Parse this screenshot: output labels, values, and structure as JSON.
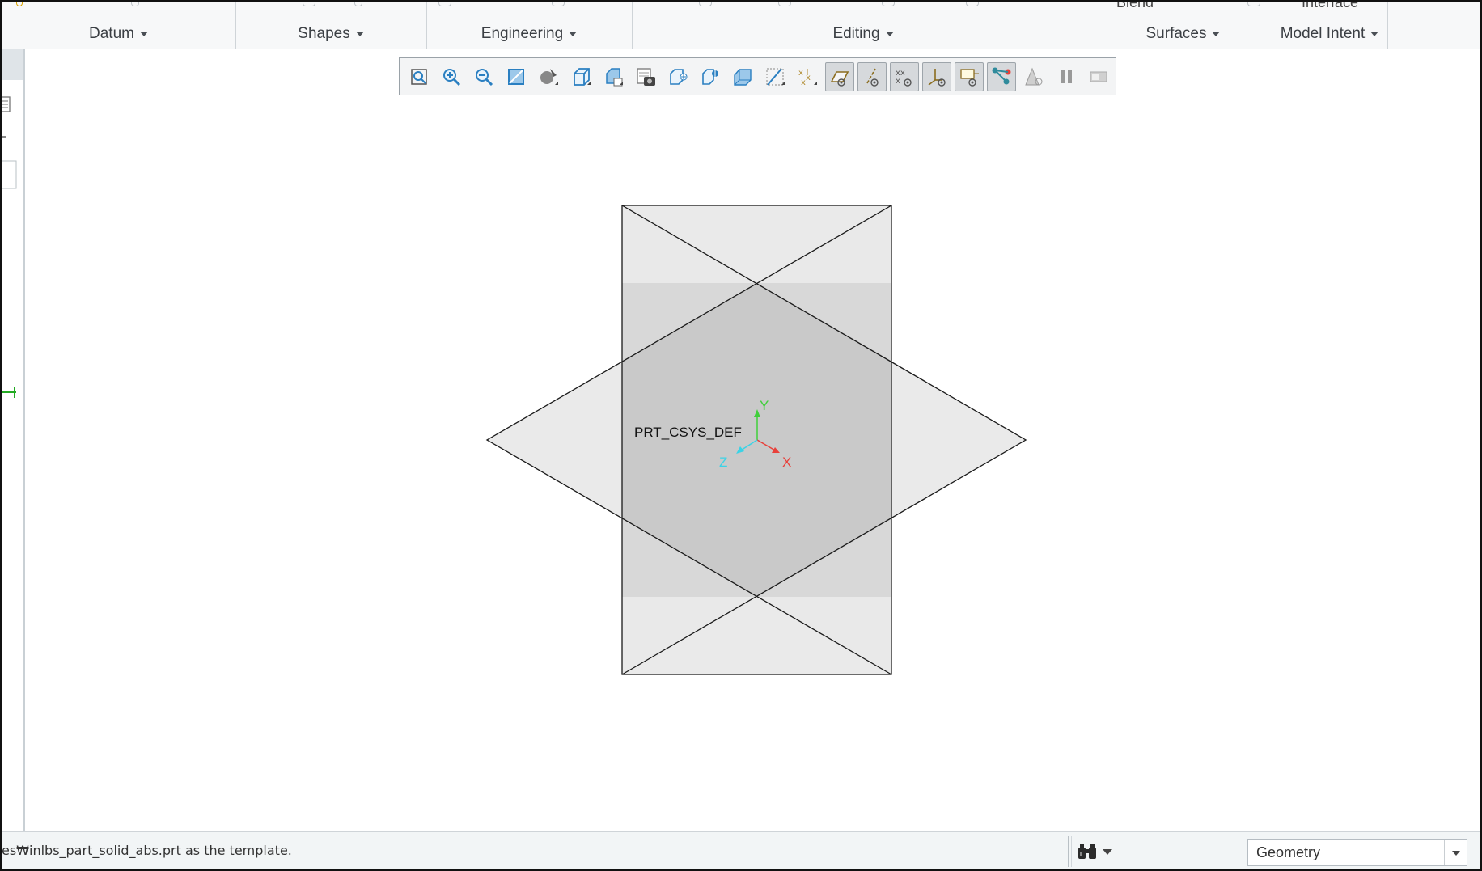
{
  "ribbon": {
    "clipped_labels": [
      "Blend",
      "Interface"
    ],
    "groups": [
      {
        "label": "Datum"
      },
      {
        "label": "Shapes"
      },
      {
        "label": "Engineering"
      },
      {
        "label": "Editing"
      },
      {
        "label": "Surfaces"
      },
      {
        "label": "Model Intent"
      }
    ]
  },
  "graphics_toolbar": {
    "buttons": [
      {
        "icon": "refit-icon",
        "active": false
      },
      {
        "icon": "zoom-in-icon",
        "active": false
      },
      {
        "icon": "zoom-out-icon",
        "active": false
      },
      {
        "icon": "repaint-icon",
        "active": false
      },
      {
        "icon": "display-style-icon",
        "active": false
      },
      {
        "icon": "saved-orientations-icon",
        "active": false
      },
      {
        "icon": "named-views-icon",
        "active": false
      },
      {
        "icon": "view-manager-icon",
        "active": false
      },
      {
        "icon": "perspective-view-icon",
        "active": false
      },
      {
        "icon": "spin-center-icon",
        "active": false
      },
      {
        "icon": "section-icon",
        "active": false
      },
      {
        "icon": "annotation-display-icon",
        "active": false
      },
      {
        "icon": "point-display-icon",
        "active": false
      },
      {
        "icon": "plane-display-icon",
        "active": true
      },
      {
        "icon": "axis-display-icon",
        "active": true
      },
      {
        "icon": "point-tag-display-icon",
        "active": true
      },
      {
        "icon": "csys-display-icon",
        "active": true
      },
      {
        "icon": "annotation-filter-icon",
        "active": true
      },
      {
        "icon": "spin-display-icon",
        "active": true
      },
      {
        "icon": "animation-icon",
        "active": false
      },
      {
        "icon": "pause-icon",
        "active": false
      },
      {
        "icon": "playback-icon",
        "active": false
      }
    ]
  },
  "model": {
    "csys_name": "PRT_CSYS_DEF",
    "axes": {
      "x": "X",
      "y": "Y",
      "z": "Z"
    }
  },
  "statusbar": {
    "message": "es₩inlbs_part_solid_abs.prt as the template.",
    "find_icon": "binoculars-icon",
    "filter_value": "Geometry"
  },
  "colors": {
    "x_axis": "#e8403a",
    "y_axis": "#3fcf3a",
    "z_axis": "#3ad3e6",
    "plane_fill": "#e6e6e6",
    "plane_overlap": "#c4c4c4"
  }
}
